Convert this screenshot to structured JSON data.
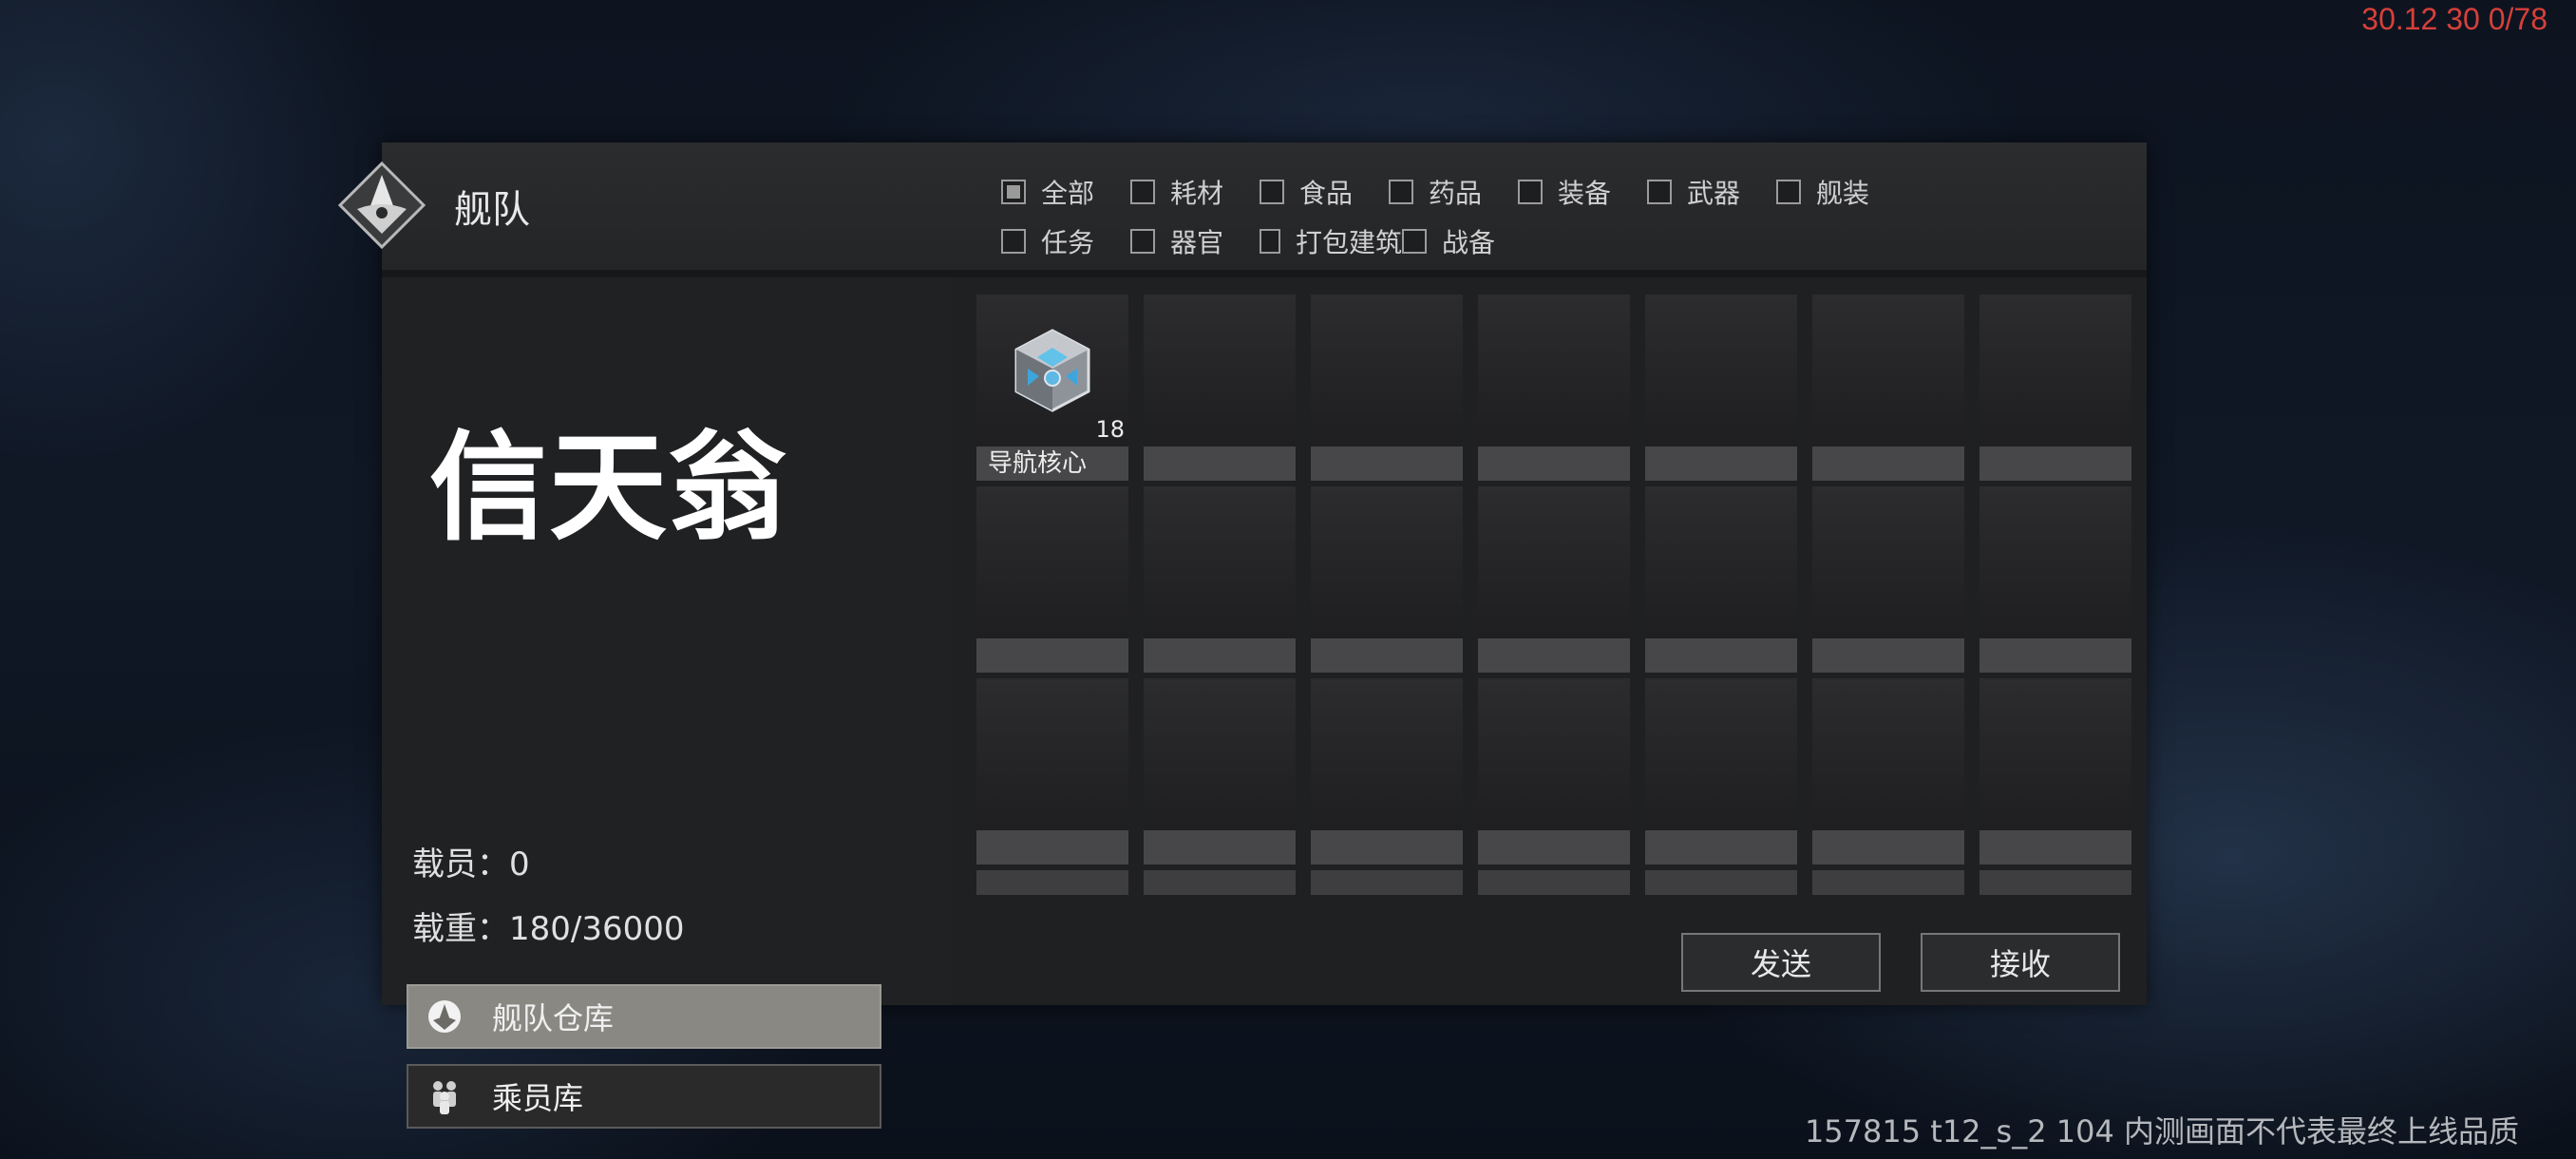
{
  "overlay": {
    "fps": "30.12 30 0/78",
    "watermark": "157815 t12_s_2 104  内测画面不代表最终上线品质"
  },
  "header": {
    "title": "舰队"
  },
  "filters": {
    "row1": [
      {
        "label": "全部",
        "checked": true
      },
      {
        "label": "耗材",
        "checked": false
      },
      {
        "label": "食品",
        "checked": false
      },
      {
        "label": "药品",
        "checked": false
      },
      {
        "label": "装备",
        "checked": false
      },
      {
        "label": "武器",
        "checked": false
      },
      {
        "label": "舰装",
        "checked": false
      }
    ],
    "row2": [
      {
        "label": "任务",
        "checked": false
      },
      {
        "label": "器官",
        "checked": false
      },
      {
        "label": "打包建筑",
        "checked": false
      },
      {
        "label": "战备",
        "checked": false
      }
    ]
  },
  "ship": {
    "name": "信天翁",
    "crew_text": "载员：0",
    "load_text": "载重：180/36000"
  },
  "side_buttons": {
    "fleet_storage": "舰队仓库",
    "crew_storage": "乘员库"
  },
  "inventory": {
    "item": {
      "name": "导航核心",
      "count": "18",
      "icon": "crystal-core-icon"
    }
  },
  "actions": {
    "send": "发送",
    "receive": "接收"
  },
  "colors": {
    "accent_active": "#8a8883",
    "fps_red": "#d6403a"
  }
}
